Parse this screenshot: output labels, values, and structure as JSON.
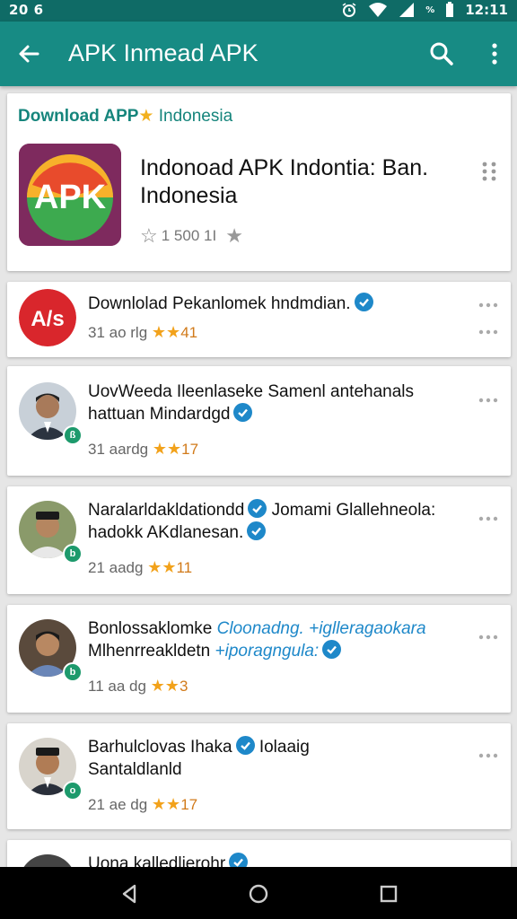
{
  "status_bar": {
    "time_left": "20 6",
    "battery_pct": "%",
    "time_right": "12:11"
  },
  "app_bar": {
    "title": "APK Inmead APK"
  },
  "hero": {
    "source_app": "Download APP",
    "source_region": "Indonesia",
    "app_icon_text": "APK",
    "title": "Indonoad APK Indontia: Ban. Indonesia",
    "rating": "1 500 1I"
  },
  "posts": [
    {
      "avatar_text": "A/s",
      "name": "Downlolad Pekanlomek hndmdian.",
      "extra": "",
      "line2": "",
      "line2_extra": "",
      "meta": "31 ao rlg",
      "count": "41"
    },
    {
      "avatar_text": "",
      "name": "UovWeeda Ileenlaseke Samenl antehanals",
      "extra": "",
      "line2": "hattuan Mindardgd",
      "line2_extra": "",
      "meta": "31 aardg",
      "count": "17"
    },
    {
      "avatar_text": "",
      "name": "Naralarldakldationdd",
      "extra": "Jomami Glallehneola:",
      "line2": "hadokk AKdlanesan.",
      "line2_extra": "",
      "meta": "21 aadg",
      "count": "11"
    },
    {
      "avatar_text": "",
      "name": "Bonlossaklomke",
      "extra": "Cloonadng. +iglleragaokara",
      "line2": "Mlhenrreakldetn",
      "line2_extra": "+iporagngula:",
      "meta": "11 aa dg",
      "count": "3"
    },
    {
      "avatar_text": "",
      "name": "Barhulclovas Ihaka",
      "extra": "Iolaaig",
      "line2": "Santaldlanld",
      "line2_extra": "",
      "meta": "21 ae dg",
      "count": "17"
    },
    {
      "avatar_text": "",
      "name": "Uona kalledlierohr",
      "extra": "",
      "line2": "",
      "line2_extra": "",
      "meta": "",
      "count": ""
    }
  ],
  "colors": {
    "app_bar": "#178b84",
    "status_bar": "#0f6b66",
    "accent_teal": "#16857c",
    "verified_blue": "#1e88c9",
    "star": "#f2a21b"
  },
  "icons": [
    "back-arrow-icon",
    "search-icon",
    "more-vert-icon",
    "grid-icon",
    "verified-icon",
    "more-horiz-icon",
    "star-icon"
  ]
}
